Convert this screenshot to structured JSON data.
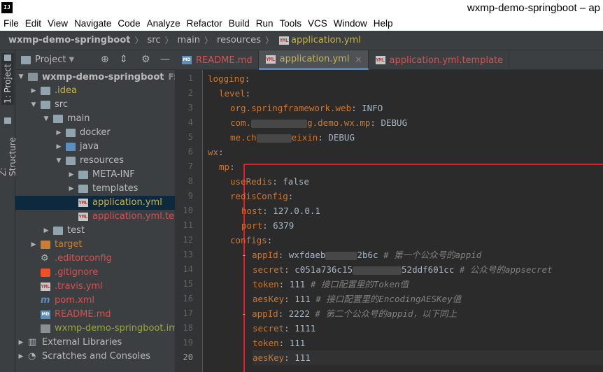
{
  "titlebar": {
    "logo": "IJ",
    "title": "wxmp-demo-springboot – ap"
  },
  "menu": [
    "File",
    "Edit",
    "View",
    "Navigate",
    "Code",
    "Analyze",
    "Refactor",
    "Build",
    "Run",
    "Tools",
    "VCS",
    "Window",
    "Help"
  ],
  "breadcrumb": [
    "wxmp-demo-springboot",
    "src",
    "main",
    "resources",
    "application.yml"
  ],
  "tool_strip": {
    "project": "1: Project",
    "structure": "Z: Structure"
  },
  "project_panel": {
    "title": "Project",
    "items": [
      {
        "label": "wxmp-demo-springboot",
        "suffix": "F:\\Cer",
        "depth": 0,
        "arrow": "down",
        "icon": "folder-dark",
        "color": "normal",
        "bold": true
      },
      {
        "label": ".idea",
        "depth": 1,
        "arrow": "right",
        "icon": "folder",
        "color": "yellow"
      },
      {
        "label": "src",
        "depth": 1,
        "arrow": "down",
        "icon": "folder",
        "color": "normal"
      },
      {
        "label": "main",
        "depth": 2,
        "arrow": "down",
        "icon": "folder",
        "color": "normal"
      },
      {
        "label": "docker",
        "depth": 3,
        "arrow": "right",
        "icon": "folder",
        "color": "normal"
      },
      {
        "label": "java",
        "depth": 3,
        "arrow": "right",
        "icon": "folder-blue",
        "color": "normal"
      },
      {
        "label": "resources",
        "depth": 3,
        "arrow": "down",
        "icon": "folder-res",
        "color": "normal"
      },
      {
        "label": "META-INF",
        "depth": 4,
        "arrow": "right",
        "icon": "folder",
        "color": "normal"
      },
      {
        "label": "templates",
        "depth": 4,
        "arrow": "right",
        "icon": "folder",
        "color": "normal"
      },
      {
        "label": "application.yml",
        "depth": 4,
        "arrow": "",
        "icon": "yml",
        "color": "yellow",
        "selected": true
      },
      {
        "label": "application.yml.template",
        "depth": 4,
        "arrow": "",
        "icon": "yml",
        "color": "red"
      },
      {
        "label": "test",
        "depth": 2,
        "arrow": "right",
        "icon": "folder",
        "color": "normal"
      },
      {
        "label": "target",
        "depth": 1,
        "arrow": "right",
        "icon": "folder-orange",
        "color": "orange"
      },
      {
        "label": ".editorconfig",
        "depth": 1,
        "arrow": "",
        "icon": "gear",
        "color": "red"
      },
      {
        "label": ".gitignore",
        "depth": 1,
        "arrow": "",
        "icon": "git",
        "color": "red"
      },
      {
        "label": ".travis.yml",
        "depth": 1,
        "arrow": "",
        "icon": "yml",
        "color": "red"
      },
      {
        "label": "pom.xml",
        "depth": 1,
        "arrow": "",
        "icon": "maven",
        "color": "red"
      },
      {
        "label": "README.md",
        "depth": 1,
        "arrow": "",
        "icon": "md",
        "color": "red"
      },
      {
        "label": "wxmp-demo-springboot.iml",
        "depth": 1,
        "arrow": "",
        "icon": "iml",
        "color": "green"
      },
      {
        "label": "External Libraries",
        "depth": 0,
        "arrow": "right",
        "icon": "libs",
        "color": "normal"
      },
      {
        "label": "Scratches and Consoles",
        "depth": 0,
        "arrow": "right",
        "icon": "scratch",
        "color": "normal"
      }
    ]
  },
  "tabs": [
    {
      "label": "README.md",
      "icon": "md",
      "color": "red",
      "active": false
    },
    {
      "label": "application.yml",
      "icon": "yml",
      "color": "yellow",
      "active": true,
      "close": "×"
    },
    {
      "label": "application.yml.template",
      "icon": "yml",
      "color": "red",
      "active": false
    }
  ],
  "editor": {
    "current_line": 20,
    "lines": [
      {
        "n": "1",
        "indent": 0,
        "key": "logging",
        "sep": ":",
        "val": "",
        "comment": ""
      },
      {
        "n": "2",
        "indent": 1,
        "key": "level",
        "sep": ":",
        "val": "",
        "comment": ""
      },
      {
        "n": "3",
        "indent": 2,
        "key": "org.springframework.web",
        "sep": ": ",
        "val": "INFO",
        "comment": ""
      },
      {
        "n": "4",
        "indent": 2,
        "key": "com.",
        "blur": 80,
        "key2": "g.demo.wx.mp",
        "sep": ": ",
        "val": "DEBUG",
        "comment": ""
      },
      {
        "n": "5",
        "indent": 2,
        "key": "me.ch",
        "blur": 50,
        "key2": "eixin",
        "sep": ": ",
        "val": "DEBUG",
        "comment": ""
      },
      {
        "n": "6",
        "indent": 0,
        "key": "wx",
        "sep": ":",
        "val": "",
        "comment": ""
      },
      {
        "n": "7",
        "indent": 1,
        "key": "mp",
        "sep": ":",
        "val": "",
        "comment": ""
      },
      {
        "n": "8",
        "indent": 2,
        "key": "useRedis",
        "sep": ": ",
        "val": "false",
        "comment": ""
      },
      {
        "n": "9",
        "indent": 2,
        "key": "redisConfig",
        "sep": ":",
        "val": "",
        "comment": ""
      },
      {
        "n": "10",
        "indent": 3,
        "key": "host",
        "sep": ": ",
        "val": "127.0.0.1",
        "comment": ""
      },
      {
        "n": "11",
        "indent": 3,
        "key": "port",
        "sep": ": ",
        "val": "6379",
        "comment": ""
      },
      {
        "n": "12",
        "indent": 2,
        "key": "configs",
        "sep": ":",
        "val": "",
        "comment": ""
      },
      {
        "n": "13",
        "indent": 3,
        "dash": true,
        "key": "appId",
        "sep": ": ",
        "val": "wxfdaeb",
        "blur": 45,
        "val2": "2b6c",
        "comment": "# 第一个公众号的appid"
      },
      {
        "n": "14",
        "indent": 4,
        "key": "secret",
        "sep": ": ",
        "val": "c051a736c15",
        "blur": 70,
        "val2": "52ddf601cc",
        "comment": "# 公众号的appsecret"
      },
      {
        "n": "15",
        "indent": 4,
        "key": "token",
        "sep": ": ",
        "val": "111",
        "comment": "# 接口配置里的Token值"
      },
      {
        "n": "16",
        "indent": 4,
        "key": "aesKey",
        "sep": ": ",
        "val": "111",
        "comment": "# 接口配置里的EncodingAESKey值"
      },
      {
        "n": "17",
        "indent": 3,
        "dash": true,
        "key": "appId",
        "sep": ": ",
        "val": "2222",
        "comment": "# 第二个公众号的appid，以下同上"
      },
      {
        "n": "18",
        "indent": 4,
        "key": "secret",
        "sep": ": ",
        "val": "1111",
        "comment": ""
      },
      {
        "n": "19",
        "indent": 4,
        "key": "token",
        "sep": ": ",
        "val": "111",
        "comment": ""
      },
      {
        "n": "20",
        "indent": 4,
        "key": "aesKey",
        "sep": ": ",
        "val": "111",
        "comment": ""
      }
    ]
  },
  "colors": {
    "highlight_box": "#e02020",
    "keyword": "#cc7832",
    "value": "#a9b7c6",
    "comment": "#808080"
  }
}
